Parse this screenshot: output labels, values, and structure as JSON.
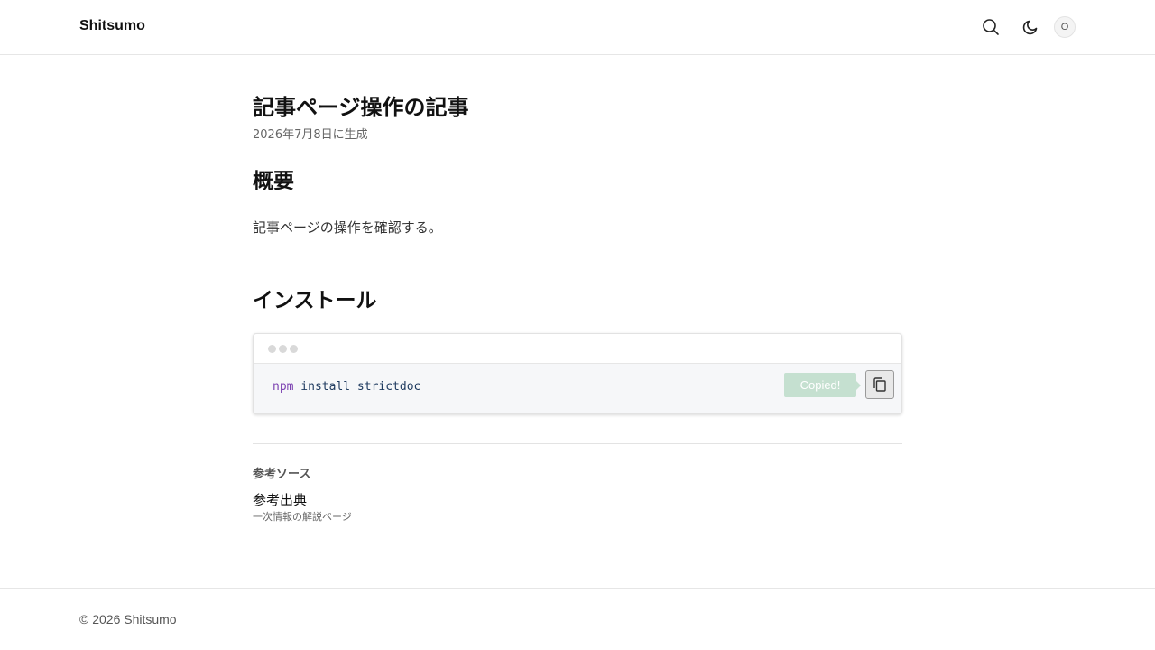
{
  "header": {
    "brand": "Shitsumo",
    "avatar_initial": "O",
    "icons": {
      "search": "search-icon",
      "theme": "moon-icon"
    }
  },
  "article": {
    "title": "記事ページ操作の記事",
    "date": "2026年7月8日に生成",
    "sections": {
      "overview": {
        "heading": "概要",
        "body": "記事ページの操作を確認する。"
      },
      "install": {
        "heading": "インストール"
      }
    },
    "code": {
      "command": "npm",
      "args": " install strictdoc",
      "tooltip": "Copied!",
      "copy_icon": "copy-icon"
    },
    "sources": {
      "label": "参考ソース",
      "items": [
        {
          "title": "参考出典",
          "description": "一次情報の解説ページ"
        }
      ]
    }
  },
  "footer": {
    "copyright": "© 2026 Shitsumo"
  },
  "colors": {
    "keyword": "#7a3fb0",
    "code_text": "#1e3a5f",
    "tooltip_bg": "#c5e0d0",
    "code_bg": "#f6f7f9"
  }
}
